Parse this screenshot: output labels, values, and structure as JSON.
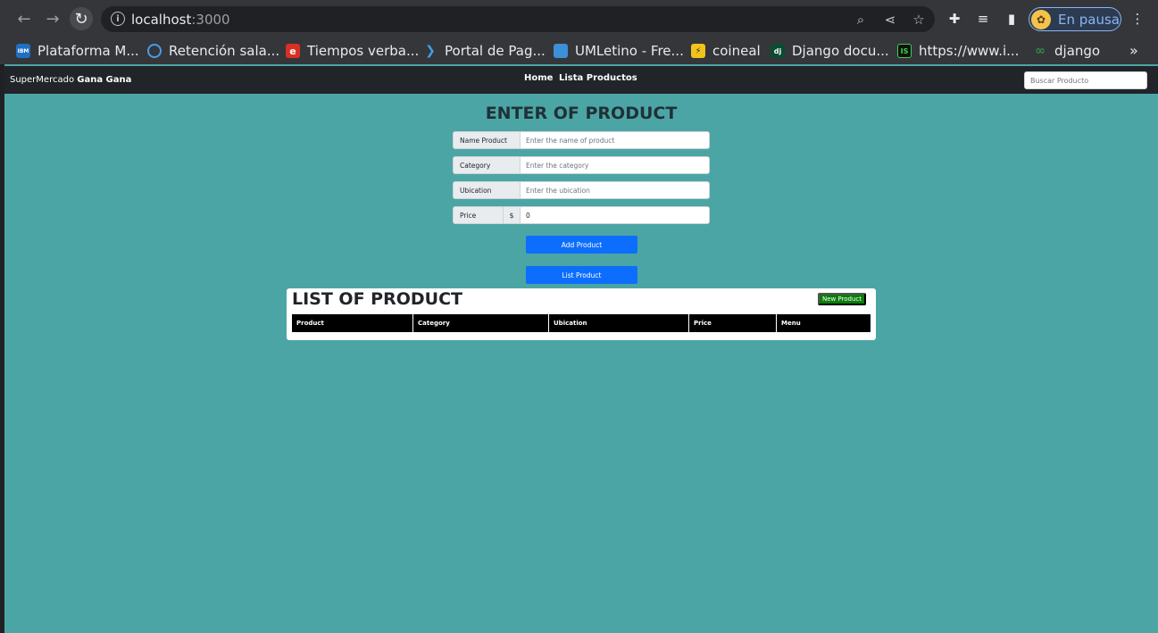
{
  "browser": {
    "url_host": "localhost",
    "url_port": ":3000",
    "profile_label": "En pausa",
    "bookmarks": [
      {
        "label": "Plataforma M...",
        "icon": "ibm-icon",
        "icon_text": "IBM",
        "color": "#1f70c1"
      },
      {
        "label": "Retención sala...",
        "icon": "chat-bubble-icon",
        "icon_text": "",
        "color": "#4a9be8"
      },
      {
        "label": "Tiempos verba...",
        "icon": "e-logo-icon",
        "icon_text": "e",
        "color": "#d93025"
      },
      {
        "label": "Portal de Pag...",
        "icon": "arrow-logo-icon",
        "icon_text": "",
        "color": "#3aa0e8"
      },
      {
        "label": "UMLetino - Fre...",
        "icon": "umletino-icon",
        "icon_text": "",
        "color": "#3d8fd6"
      },
      {
        "label": "coineal",
        "icon": "lightning-icon",
        "icon_text": "⚡",
        "color": "#f2c31b"
      },
      {
        "label": "Django docu...",
        "icon": "django-icon",
        "icon_text": "dj",
        "color": "#0c4b33"
      },
      {
        "label": "https://www.i...",
        "icon": "is-logo-icon",
        "icon_text": "IS",
        "color": "#111111"
      },
      {
        "label": "django",
        "icon": "django-link-icon",
        "icon_text": "∞",
        "color": "#2f8f46"
      }
    ]
  },
  "app": {
    "brand_prefix": "SuperMercado ",
    "brand_bold": "Gana Gana",
    "nav_links": [
      "Home",
      "Lista Productos"
    ],
    "search_placeholder": "Buscar Producto",
    "colors": {
      "background": "#4ca5a5",
      "primary": "#0d6efd",
      "success": "#0a7d0a",
      "navbar": "#212529"
    }
  },
  "form": {
    "title": "ENTER OF PRODUCT",
    "fields": [
      {
        "label": "Name Product",
        "placeholder": "Enter the name of product",
        "value": ""
      },
      {
        "label": "Category",
        "placeholder": "Enter the category",
        "value": ""
      },
      {
        "label": "Ubication",
        "placeholder": "Enter the ubication",
        "value": ""
      },
      {
        "label": "Price",
        "prefix": "$",
        "placeholder": "",
        "value": "0"
      }
    ],
    "add_button": "Add Product",
    "list_button": "List Product"
  },
  "list": {
    "title": "LIST OF PRODUCT",
    "new_button": "New Product",
    "columns": [
      "Product",
      "Category",
      "Ubication",
      "Price",
      "Menu"
    ]
  }
}
